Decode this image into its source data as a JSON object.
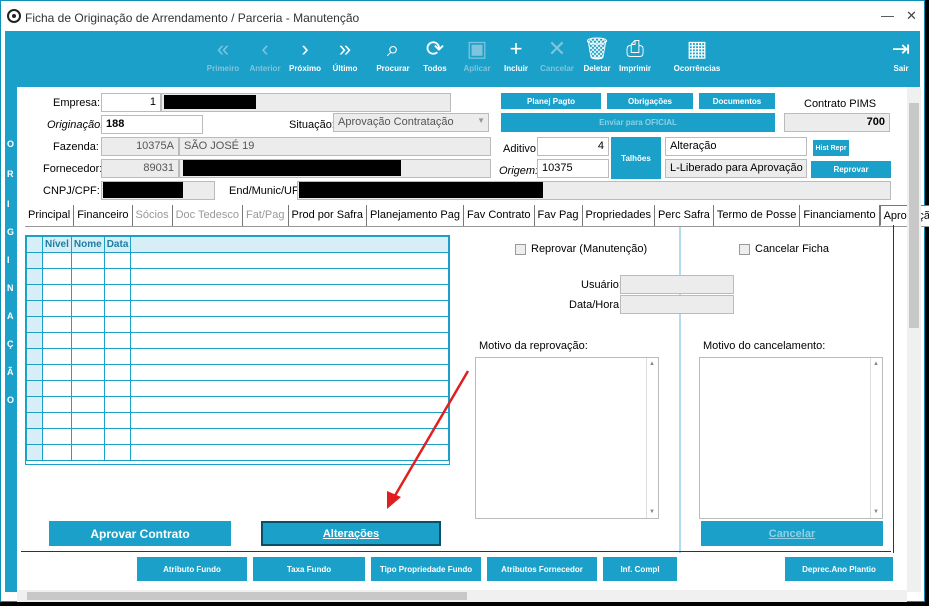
{
  "window": {
    "title": "Ficha de Originação de Arrendamento / Parceria - Manutenção",
    "btn_min": "—",
    "btn_close": "✕"
  },
  "toolbar": [
    {
      "label": "Primeiro",
      "icon": "«",
      "disabled": true
    },
    {
      "label": "Anterior",
      "icon": "‹",
      "disabled": true
    },
    {
      "label": "Próximo",
      "icon": "›",
      "disabled": false
    },
    {
      "label": "Último",
      "icon": "»",
      "disabled": false
    },
    {
      "label": "Procurar",
      "icon": "⌕",
      "disabled": false
    },
    {
      "label": "Todos",
      "icon": "⟳",
      "disabled": false
    },
    {
      "label": "Aplicar",
      "icon": "▣",
      "disabled": true
    },
    {
      "label": "Incluir",
      "icon": "+",
      "disabled": false
    },
    {
      "label": "Cancelar",
      "icon": "✕",
      "disabled": true
    },
    {
      "label": "Deletar",
      "icon": "🗑",
      "disabled": false
    },
    {
      "label": "Imprimir",
      "icon": "⎙",
      "disabled": false
    },
    {
      "label": "Ocorrências",
      "icon": "▦",
      "disabled": false
    },
    {
      "label": "Sair",
      "icon": "⇥",
      "disabled": false
    }
  ],
  "side_letters": [
    "O",
    "R",
    "I",
    "G",
    "I",
    "N",
    "A",
    "Ç",
    "Ã",
    "O"
  ],
  "form": {
    "empresa_label": "Empresa:",
    "empresa_value": "1",
    "originacao_label": "Originação:",
    "originacao_value": "188",
    "situacao_label": "Situação:",
    "situacao_value": "Aprovação Contratação",
    "fazenda_label": "Fazenda:",
    "fazenda_code": "10375A",
    "fazenda_name": "SÃO JOSÉ 19",
    "fornecedor_label": "Fornecedor:",
    "fornecedor_code": "89031",
    "cnpj_label": "CNPJ/CPF:",
    "endmunic_label": "End/Munic/UF:",
    "aditivo_label": "Aditivo:",
    "aditivo_value": "4",
    "origem_label": "Origem:",
    "origem_value": "10375",
    "alteracao_value": "Alteração",
    "liberado_value": "L-Liberado para Aprovação",
    "contrato_pims_label": "Contrato PIMS",
    "contrato_pims_value": "700"
  },
  "buttons": {
    "planej_pagto": "Planej Pagto",
    "obrigacoes": "Obrigações",
    "documentos": "Documentos",
    "enviar_oficial": "Enviar para OFICIAL",
    "talhoes": "Talhões",
    "hist_repr": "Hist Repr",
    "reprovar": "Reprovar",
    "aprovar_contrato": "Aprovar Contrato",
    "alteracoes": "Alterações",
    "cancelar": "Cancelar",
    "atributo_fundo": "Atributo Fundo",
    "taxa_fundo": "Taxa Fundo",
    "tipo_propriedade_fundo": "Tipo Propriedade Fundo",
    "atributos_fornecedor": "Atributos Fornecedor",
    "inf_compl": "Inf. Compl",
    "deprec_ano_plantio": "Deprec.Ano Plantio"
  },
  "tabs": [
    {
      "label": "Principal",
      "state": "normal"
    },
    {
      "label": "Financeiro",
      "state": "normal"
    },
    {
      "label": "Sócios",
      "state": "disabled"
    },
    {
      "label": "Doc Tedesco",
      "state": "disabled"
    },
    {
      "label": "Fat/Pag",
      "state": "disabled"
    },
    {
      "label": "Prod por Safra",
      "state": "normal"
    },
    {
      "label": "Planejamento Pag",
      "state": "normal"
    },
    {
      "label": "Fav Contrato",
      "state": "normal"
    },
    {
      "label": "Fav Pag",
      "state": "normal"
    },
    {
      "label": "Propriedades",
      "state": "normal"
    },
    {
      "label": "Perc Safra",
      "state": "normal"
    },
    {
      "label": "Termo de Posse",
      "state": "normal"
    },
    {
      "label": "Financiamento",
      "state": "normal"
    },
    {
      "label": "Aprovação",
      "state": "active"
    }
  ],
  "grid": {
    "columns": [
      "",
      "Nível",
      "Nome",
      "Data",
      ""
    ]
  },
  "aprovacao": {
    "reprovar_manutencao": "Reprovar (Manutenção)",
    "cancelar_ficha": "Cancelar Ficha",
    "usuario_label": "Usuário:",
    "datahora_label": "Data/Hora:",
    "motivo_reprovacao_label": "Motivo da reprovação:",
    "motivo_cancelamento_label": "Motivo do cancelamento:"
  },
  "colors": {
    "accent": "#1ba0c9",
    "annotation_arrow": "#e02020"
  }
}
